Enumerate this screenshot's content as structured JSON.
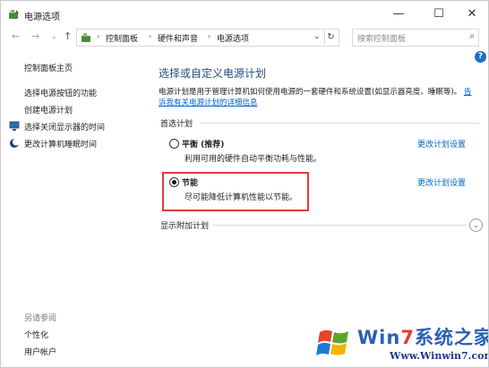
{
  "window": {
    "title": "电源选项",
    "controls": {
      "minimize": "—",
      "maximize": "☐",
      "close": "✕"
    }
  },
  "address": {
    "back": "←",
    "forward": "→",
    "up": "↑",
    "breadcrumbs": [
      "控制面板",
      "硬件和声音",
      "电源选项"
    ],
    "separator": "›",
    "dropdown": "⌄",
    "refresh": "↻"
  },
  "search": {
    "placeholder": "搜索控制面板",
    "icon": "⌕"
  },
  "help": {
    "label": "?"
  },
  "sidebar": {
    "home": "控制面板主页",
    "items": [
      {
        "label": "选择电源按钮的功能",
        "icon": ""
      },
      {
        "label": "创建电源计划",
        "icon": ""
      },
      {
        "label": "选择关闭显示器的时间",
        "icon": "monitor-icon"
      },
      {
        "label": "更改计算机睡眠时间",
        "icon": "moon-icon"
      }
    ],
    "see_also": "另请参阅",
    "see_also_items": [
      "个性化",
      "用户帐户"
    ]
  },
  "main": {
    "title": "选择或自定义电源计划",
    "description": "电源计划是用于管理计算机如何使用电源的一套硬件和系统设置(如显示器亮度、睡眠等)。",
    "description_link": "告诉我有关电源计划的详细信息",
    "preferred_label": "首选计划",
    "plans": [
      {
        "name": "平衡 (推荐)",
        "desc": "利用可用的硬件自动平衡功耗与性能。",
        "link": "更改计划设置",
        "selected": false
      },
      {
        "name": "节能",
        "desc": "尽可能降低计算机性能以节能。",
        "link": "更改计划设置",
        "selected": true
      }
    ],
    "extra_label": "显示附加计划",
    "expander": "⌄"
  },
  "watermark": {
    "title": "Win7系统之家",
    "url": "Www.Winwin7.com"
  },
  "colors": {
    "accent_title": "#1f4e79",
    "link": "#0066cc",
    "highlight_border": "#e23b3b",
    "help_bg": "#1d6ec4"
  }
}
